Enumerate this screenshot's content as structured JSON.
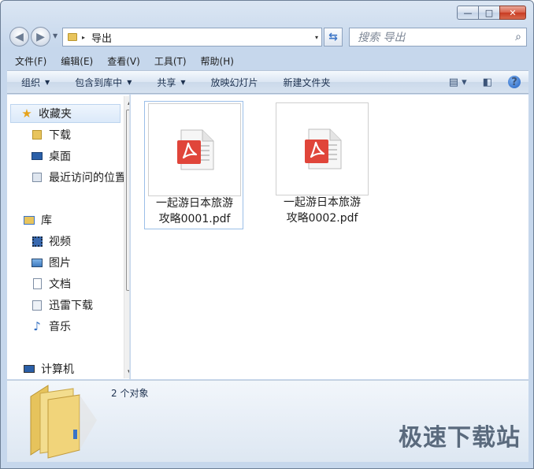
{
  "window": {
    "caption_buttons": {
      "minimize": "—",
      "maximize": "□",
      "close": "✕"
    }
  },
  "address": {
    "path": "导出",
    "chevron": "▸",
    "dropdown": "▾"
  },
  "search": {
    "placeholder": "搜索 导出"
  },
  "menu": [
    "文件(F)",
    "编辑(E)",
    "查看(V)",
    "工具(T)",
    "帮助(H)"
  ],
  "toolbar": {
    "organize": "组织",
    "include_in_library": "包含到库中",
    "share": "共享",
    "slideshow": "放映幻灯片",
    "new_folder": "新建文件夹",
    "help": "?"
  },
  "nav": {
    "favorites": "收藏夹",
    "downloads": "下载",
    "desktop": "桌面",
    "recent": "最近访问的位置",
    "libraries": "库",
    "videos": "视频",
    "pictures": "图片",
    "documents": "文档",
    "xunlei": "迅雷下载",
    "music": "音乐",
    "computer": "计算机"
  },
  "files": [
    {
      "line1": "一起游日本旅游",
      "line2": "攻略0001.pdf"
    },
    {
      "line1": "一起游日本旅游",
      "line2": "攻略0002.pdf"
    }
  ],
  "status": {
    "count": "2 个对象"
  },
  "watermark": "极速下载站",
  "colors": {
    "pdf_red": "#e0453a",
    "folder_yellow": "#e8c45c",
    "accent": "#3a74c7"
  }
}
